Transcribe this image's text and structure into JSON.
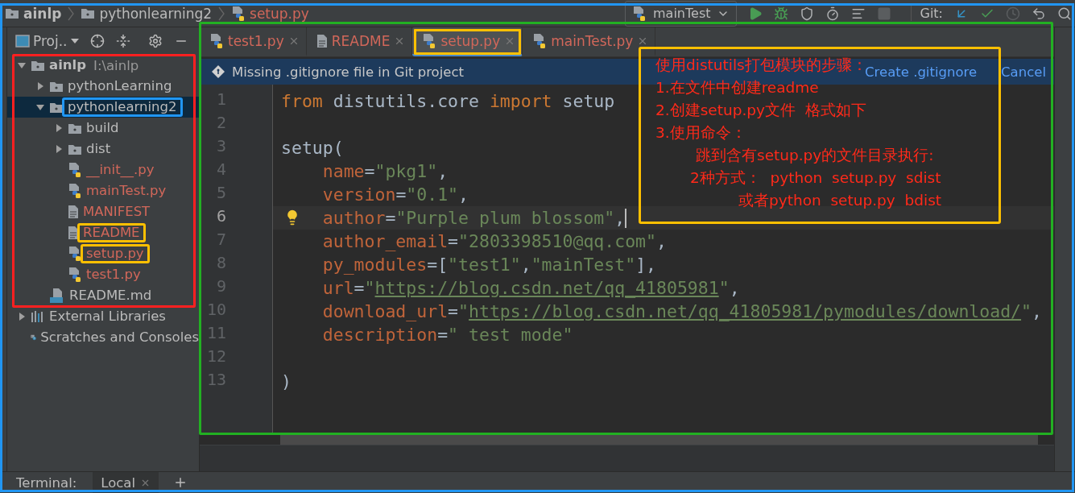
{
  "breadcrumbs": [
    {
      "label": "ainlp",
      "kind": "folder",
      "bold": true,
      "unversioned": false
    },
    {
      "label": "pythonlearning2",
      "kind": "folder",
      "bold": false,
      "unversioned": false
    },
    {
      "label": "setup.py",
      "kind": "python",
      "bold": false,
      "unversioned": true
    }
  ],
  "toolbar": {
    "run_config": "mainTest",
    "git_label": "Git:"
  },
  "project_panel": {
    "view": "Proj..",
    "tree": [
      {
        "label": "ainlp",
        "path": "I:\\ainlp",
        "kind": "folder",
        "bold": true,
        "expanded": true,
        "selected": false,
        "unversioned": false,
        "framed": true,
        "children": [
          {
            "label": "pythonLearning",
            "kind": "folder",
            "expanded": false,
            "selected": false,
            "unversioned": false,
            "framed": false
          },
          {
            "label": "pythonlearning2",
            "kind": "folder",
            "expanded": true,
            "selected": true,
            "unversioned": false,
            "framed": true,
            "children": [
              {
                "label": "build",
                "kind": "folder",
                "expanded": false,
                "selected": false,
                "unversioned": false,
                "framed": false
              },
              {
                "label": "dist",
                "kind": "folder",
                "expanded": false,
                "selected": false,
                "unversioned": false,
                "framed": false
              },
              {
                "label": "__init__.py",
                "kind": "python",
                "selected": false,
                "unversioned": true,
                "framed": false
              },
              {
                "label": "mainTest.py",
                "kind": "python",
                "selected": false,
                "unversioned": true,
                "framed": false
              },
              {
                "label": "MANIFEST",
                "kind": "text",
                "selected": false,
                "unversioned": true,
                "framed": false
              },
              {
                "label": "README",
                "kind": "text",
                "selected": false,
                "unversioned": true,
                "framed": true
              },
              {
                "label": "setup.py",
                "kind": "python",
                "selected": false,
                "unversioned": true,
                "framed": true
              },
              {
                "label": "test1.py",
                "kind": "python",
                "selected": false,
                "unversioned": true,
                "framed": false
              }
            ]
          },
          {
            "label": "README.md",
            "kind": "markdown",
            "selected": false,
            "unversioned": false,
            "framed": false
          }
        ]
      },
      {
        "label": "External Libraries",
        "kind": "libraries",
        "expanded": false,
        "selected": false,
        "unversioned": false,
        "framed": false
      },
      {
        "label": "Scratches and Consoles",
        "kind": "scratches",
        "selected": false,
        "unversioned": false,
        "framed": false
      }
    ]
  },
  "tabs": [
    {
      "label": "test1.py",
      "kind": "python",
      "selected": false,
      "framed": false
    },
    {
      "label": "README",
      "kind": "text",
      "selected": false,
      "framed": false
    },
    {
      "label": "setup.py",
      "kind": "python",
      "selected": true,
      "framed": true
    },
    {
      "label": "mainTest.py",
      "kind": "python",
      "selected": false,
      "framed": false
    }
  ],
  "notification": {
    "message": "Missing .gitignore file in Git project",
    "actions": [
      "Create .gitignore",
      "Cancel"
    ]
  },
  "code": {
    "lines": [
      {
        "number": "1",
        "current": false,
        "indented": false,
        "tokens": [
          {
            "kind": "keyword",
            "text": "from"
          },
          {
            "kind": "plain",
            "text": " distutils.core "
          },
          {
            "kind": "keyword",
            "text": "import"
          },
          {
            "kind": "plain",
            "text": " setup"
          }
        ]
      },
      {
        "number": "2",
        "current": false
      },
      {
        "number": "3",
        "current": false,
        "indented": false,
        "tokens": [
          {
            "kind": "plain",
            "text": "setup("
          }
        ]
      },
      {
        "number": "4",
        "current": false,
        "indented": true,
        "tokens": [
          {
            "kind": "param",
            "text": "name"
          },
          {
            "kind": "plain",
            "text": "="
          },
          {
            "kind": "string",
            "text": "\"pkg1\""
          },
          {
            "kind": "plain",
            "text": ","
          }
        ]
      },
      {
        "number": "5",
        "current": false,
        "indented": true,
        "tokens": [
          {
            "kind": "param",
            "text": "version"
          },
          {
            "kind": "plain",
            "text": "="
          },
          {
            "kind": "string",
            "text": "\"0.1\""
          },
          {
            "kind": "plain",
            "text": ","
          }
        ]
      },
      {
        "number": "6",
        "current": true,
        "indented": true,
        "tokens": [
          {
            "kind": "param",
            "text": "author"
          },
          {
            "kind": "plain",
            "text": "="
          },
          {
            "kind": "string",
            "text": "\"Purple plum blossom\""
          },
          {
            "kind": "plain",
            "text": ","
          }
        ]
      },
      {
        "number": "7",
        "current": false,
        "indented": true,
        "tokens": [
          {
            "kind": "param",
            "text": "author_email"
          },
          {
            "kind": "plain",
            "text": "="
          },
          {
            "kind": "string",
            "text": "\"2803398510@qq.com\""
          },
          {
            "kind": "plain",
            "text": ","
          }
        ]
      },
      {
        "number": "8",
        "current": false,
        "indented": true,
        "tokens": [
          {
            "kind": "param",
            "text": "py_modules"
          },
          {
            "kind": "plain",
            "text": "=["
          },
          {
            "kind": "string",
            "text": "\"test1\""
          },
          {
            "kind": "plain",
            "text": ","
          },
          {
            "kind": "string",
            "text": "\"mainTest\""
          },
          {
            "kind": "plain",
            "text": "],"
          }
        ]
      },
      {
        "number": "9",
        "current": false,
        "indented": true,
        "tokens": [
          {
            "kind": "param",
            "text": "url"
          },
          {
            "kind": "plain",
            "text": "="
          },
          {
            "kind": "string",
            "text": "\""
          },
          {
            "kind": "link",
            "text": "https://blog.csdn.net/qq_41805981"
          },
          {
            "kind": "string",
            "text": "\""
          },
          {
            "kind": "plain",
            "text": ","
          }
        ]
      },
      {
        "number": "10",
        "current": false,
        "indented": true,
        "tokens": [
          {
            "kind": "param",
            "text": "download_url"
          },
          {
            "kind": "plain",
            "text": "="
          },
          {
            "kind": "string",
            "text": "\""
          },
          {
            "kind": "link",
            "text": "https://blog.csdn.net/qq_41805981/pymodules/download/"
          },
          {
            "kind": "string",
            "text": "\""
          },
          {
            "kind": "plain",
            "text": ","
          }
        ]
      },
      {
        "number": "11",
        "current": false,
        "indented": true,
        "tokens": [
          {
            "kind": "param",
            "text": "description"
          },
          {
            "kind": "plain",
            "text": "="
          },
          {
            "kind": "string",
            "text": "\" test mode\""
          }
        ]
      },
      {
        "number": "12",
        "current": false
      },
      {
        "number": "13",
        "current": false,
        "indented": false,
        "tokens": [
          {
            "kind": "plain",
            "text": ")"
          }
        ]
      }
    ]
  },
  "annotation": {
    "lines": [
      {
        "kind": "title",
        "text": "使用distutils打包模块的步骤："
      },
      {
        "kind": "step",
        "text": "1.在文件中创建readme"
      },
      {
        "kind": "step",
        "text": "2.创建setup.py文件  格式如下"
      },
      {
        "kind": "step",
        "text": "3.使用命令："
      },
      {
        "kind": "detail",
        "text": "跳到含有setup.py的文件目录执行:"
      },
      {
        "kind": "command",
        "text": "2种方式：  python  setup.py  sdist"
      },
      {
        "kind": "alt",
        "text": "或者python  setup.py  bdist"
      }
    ]
  },
  "terminal": {
    "label": "Terminal:",
    "tabs": [
      {
        "label": "Local",
        "selected": true
      }
    ]
  }
}
